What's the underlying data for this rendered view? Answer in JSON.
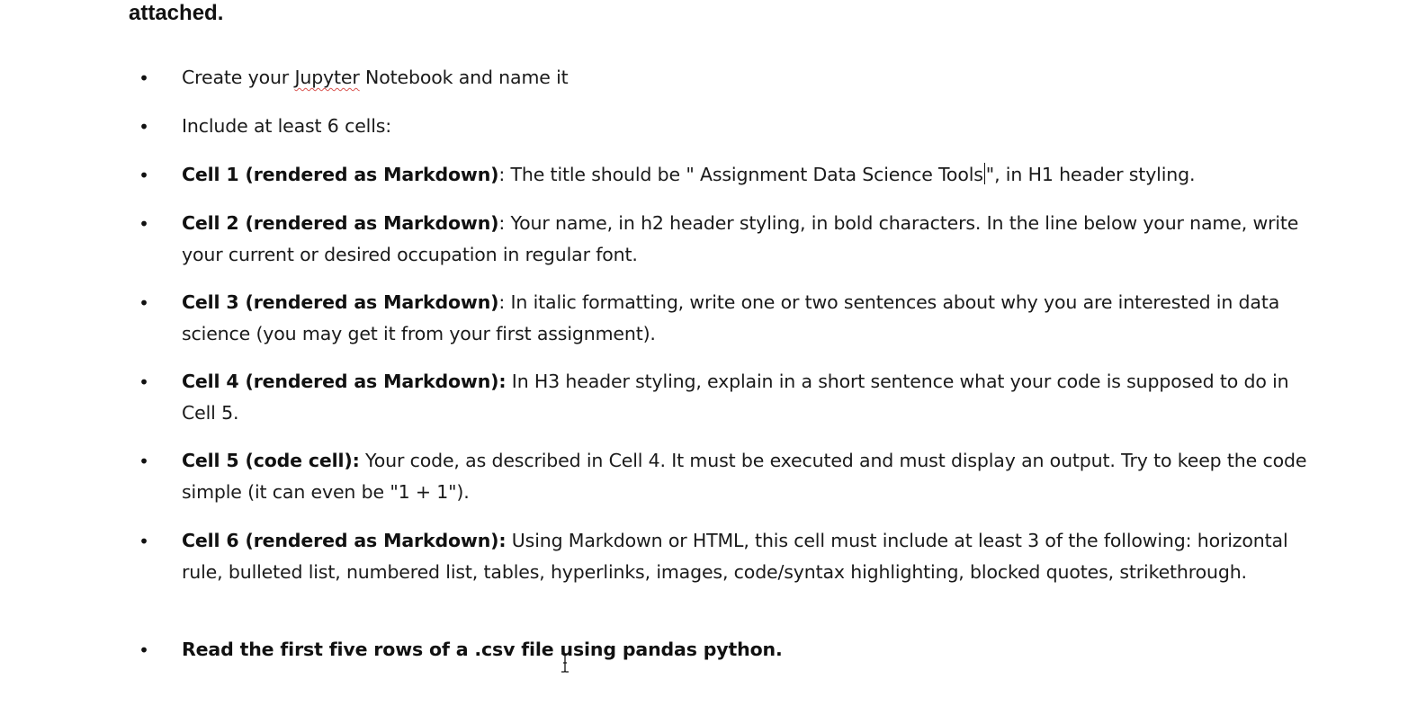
{
  "document": {
    "heading": "attached.",
    "items": [
      {
        "plain": "Create your ",
        "misspelled": "Jupyter",
        "plain2": " Notebook and name it"
      },
      {
        "plain": "Include at least 6 cells:"
      },
      {
        "bold": "Cell 1 (rendered as Markdown)",
        "plain": ": The title should be \" Assignment Data Science Tools",
        "plain2": "\", in H1 header styling."
      },
      {
        "bold": "Cell 2 (rendered as Markdown)",
        "plain": ": Your name, in h2 header styling, in bold characters. In the line below your name, write your current or desired occupation in regular font."
      },
      {
        "bold": "Cell 3 (rendered as Markdown)",
        "plain": ": In italic formatting, write one or two sentences about why you are interested in data science (you may get it from your first assignment)."
      },
      {
        "bold": "Cell 4 (rendered as Markdown):",
        "plain": " In H3 header styling, explain in a short sentence what your code is supposed to do in Cell 5."
      },
      {
        "bold": "Cell 5 (code cell):",
        "plain": " Your code, as described in Cell 4. It must be executed and must display an output. Try to keep the code simple (it can even be \"1 + 1\")."
      },
      {
        "bold": "Cell 6 (rendered as Markdown):",
        "plain": " Using Markdown or HTML, this cell must include at least 3 of the following: horizontal rule, bulleted list, numbered list, tables, hyperlinks, images, code/syntax highlighting, blocked quotes, strikethrough."
      },
      {
        "bold": "Read the first five rows of a .csv file using pandas python."
      }
    ],
    "bullet_glyph": "•"
  },
  "icons": {
    "text_cursor": "text-caret-icon",
    "mouse_cursor": "ibeam-cursor-icon"
  },
  "colors": {
    "text": "#1a1a1a",
    "spellcheck_underline": "#d9534f"
  }
}
